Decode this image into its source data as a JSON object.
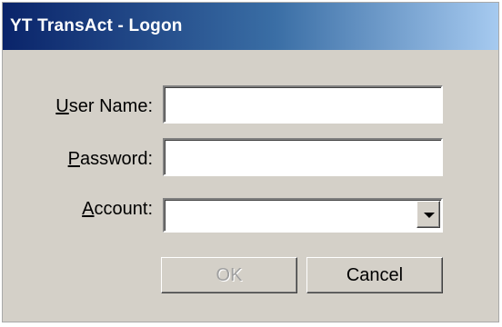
{
  "window": {
    "title": "YT TransAct - Logon"
  },
  "form": {
    "username": {
      "label_hotkey": "U",
      "label_rest": "ser Name:",
      "value": ""
    },
    "password": {
      "label_hotkey": "P",
      "label_rest": "assword:",
      "value": ""
    },
    "account": {
      "label_hotkey": "A",
      "label_rest": "ccount:",
      "value": ""
    }
  },
  "buttons": {
    "ok_label": "OK",
    "ok_enabled": false,
    "cancel_label": "Cancel"
  },
  "icons": {
    "dropdown": "chevron-down-icon"
  },
  "colors": {
    "title_gradient_start": "#0a246a",
    "title_gradient_end": "#a6caf0",
    "dialog_background": "#d4d0c8"
  }
}
